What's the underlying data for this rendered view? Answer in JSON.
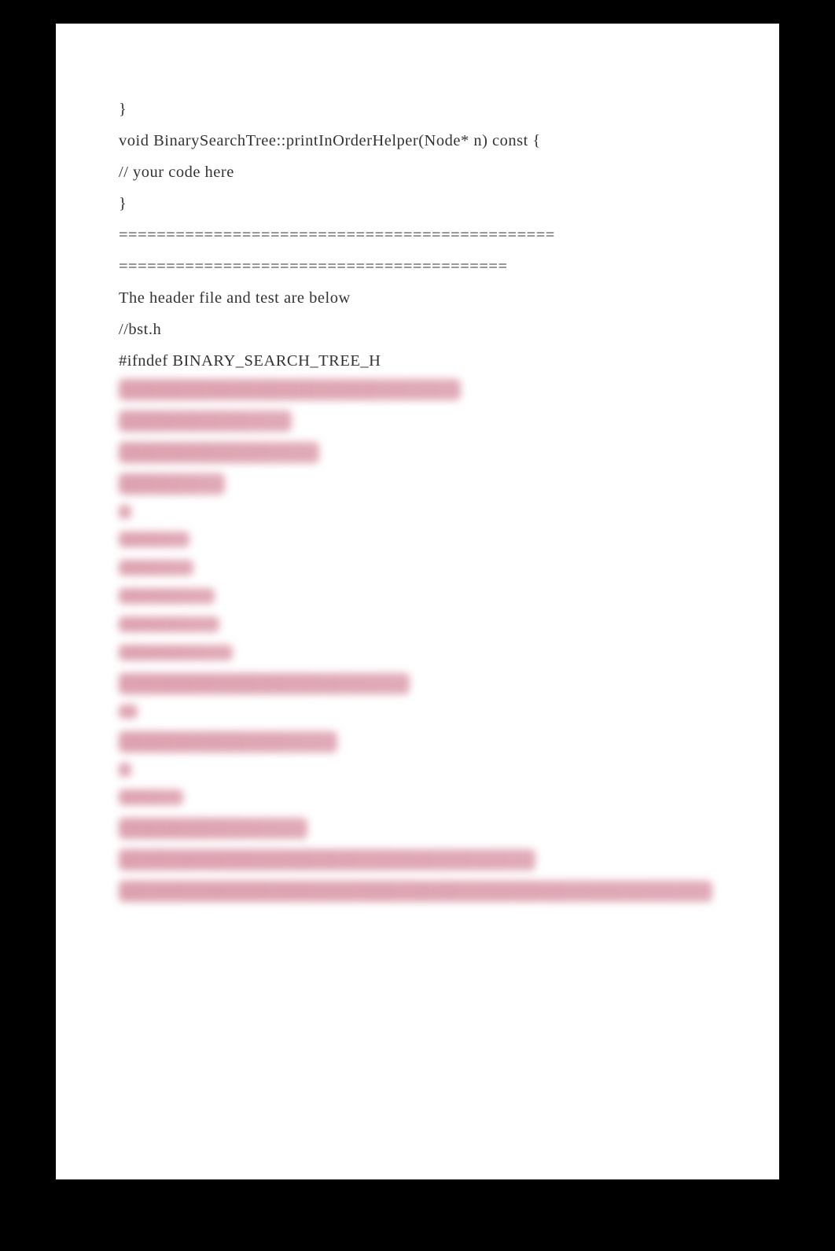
{
  "code": {
    "line1": "}",
    "line2": "void BinarySearchTree::printInOrderHelper(Node* n) const {",
    "line3": "// your code here",
    "line4": "}",
    "line5": "",
    "line6": "==============================================",
    "line7": "=========================================",
    "line8": "The header file and test are below",
    "line9": "//bst.h",
    "line10": "#ifndef BINARY_SEARCH_TREE_H"
  }
}
